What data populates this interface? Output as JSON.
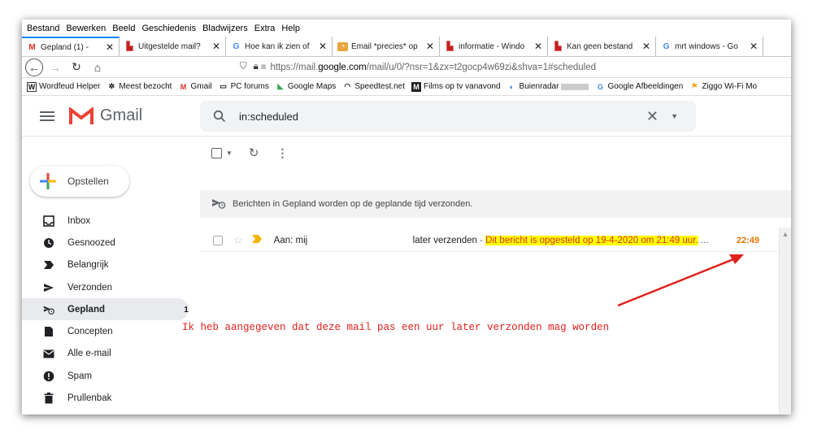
{
  "menu": [
    "Bestand",
    "Bewerken",
    "Beeld",
    "Geschiedenis",
    "Bladwijzers",
    "Extra",
    "Help"
  ],
  "tabs": [
    {
      "label": "Gepland (1) -",
      "icon": "gmail-icon",
      "color": "#d93025",
      "active": true
    },
    {
      "label": "Uitgestelde mail?",
      "icon": "forum-icon",
      "color": "#c5221f",
      "active": false
    },
    {
      "label": "Hoe kan ik zien of",
      "icon": "google-icon",
      "color": "#4285f4",
      "active": false
    },
    {
      "label": "Email *precies* op",
      "icon": "clock-icon",
      "color": "#e8a33b",
      "active": false
    },
    {
      "label": "informatie - Windo",
      "icon": "forum-icon",
      "color": "#c5221f",
      "active": false
    },
    {
      "label": "Kan geen bestand",
      "icon": "forum-icon",
      "color": "#c5221f",
      "active": false
    },
    {
      "label": "mrt windows - Go",
      "icon": "google-icon",
      "color": "#4285f4",
      "active": false
    }
  ],
  "url": {
    "prefix": "https://mail.",
    "host": "google.com",
    "path": "/mail/u/0/?nsr=1&zx=t2gocp4w69zi&shva=1#scheduled"
  },
  "bookmarks": [
    "Wordfeud Helper",
    "Meest bezocht",
    "Gmail",
    "PC forums",
    "Google Maps",
    "Speedtest.net",
    "Films op tv vanavond",
    "Buienradar",
    "Google Afbeeldingen",
    "Ziggo Wi-Fi Mo"
  ],
  "gmail": {
    "logo_text": "Gmail",
    "search_value": "in:scheduled",
    "compose_label": "Opstellen"
  },
  "nav": [
    {
      "label": "Inbox",
      "icon": "inbox-icon",
      "active": false,
      "count": ""
    },
    {
      "label": "Gesnoozed",
      "icon": "snooze-clock-icon",
      "active": false,
      "count": ""
    },
    {
      "label": "Belangrijk",
      "icon": "important-icon",
      "active": false,
      "count": ""
    },
    {
      "label": "Verzonden",
      "icon": "send-icon",
      "active": false,
      "count": ""
    },
    {
      "label": "Gepland",
      "icon": "scheduled-send-icon",
      "active": true,
      "count": "1"
    },
    {
      "label": "Concepten",
      "icon": "draft-icon",
      "active": false,
      "count": ""
    },
    {
      "label": "Alle e-mail",
      "icon": "mail-icon",
      "active": false,
      "count": ""
    },
    {
      "label": "Spam",
      "icon": "spam-icon",
      "active": false,
      "count": ""
    },
    {
      "label": "Prullenbak",
      "icon": "trash-icon",
      "active": false,
      "count": ""
    }
  ],
  "notice": "Berichten in Gepland worden op de geplande tijd verzonden.",
  "message": {
    "to": "Aan: mij",
    "subject": "later verzenden",
    "separator": " - ",
    "snippet": "Dit bericht is opgesteld op 19-4-2020 om 21:49 uur.",
    "ellipsis": " ...",
    "time": "22:49"
  },
  "annotation": "Ik heb aangegeven dat deze mail pas een uur later verzonden mag worden",
  "colors": {
    "annotation": "#e0201b",
    "highlight": "#ffff00",
    "time": "#e37400"
  }
}
